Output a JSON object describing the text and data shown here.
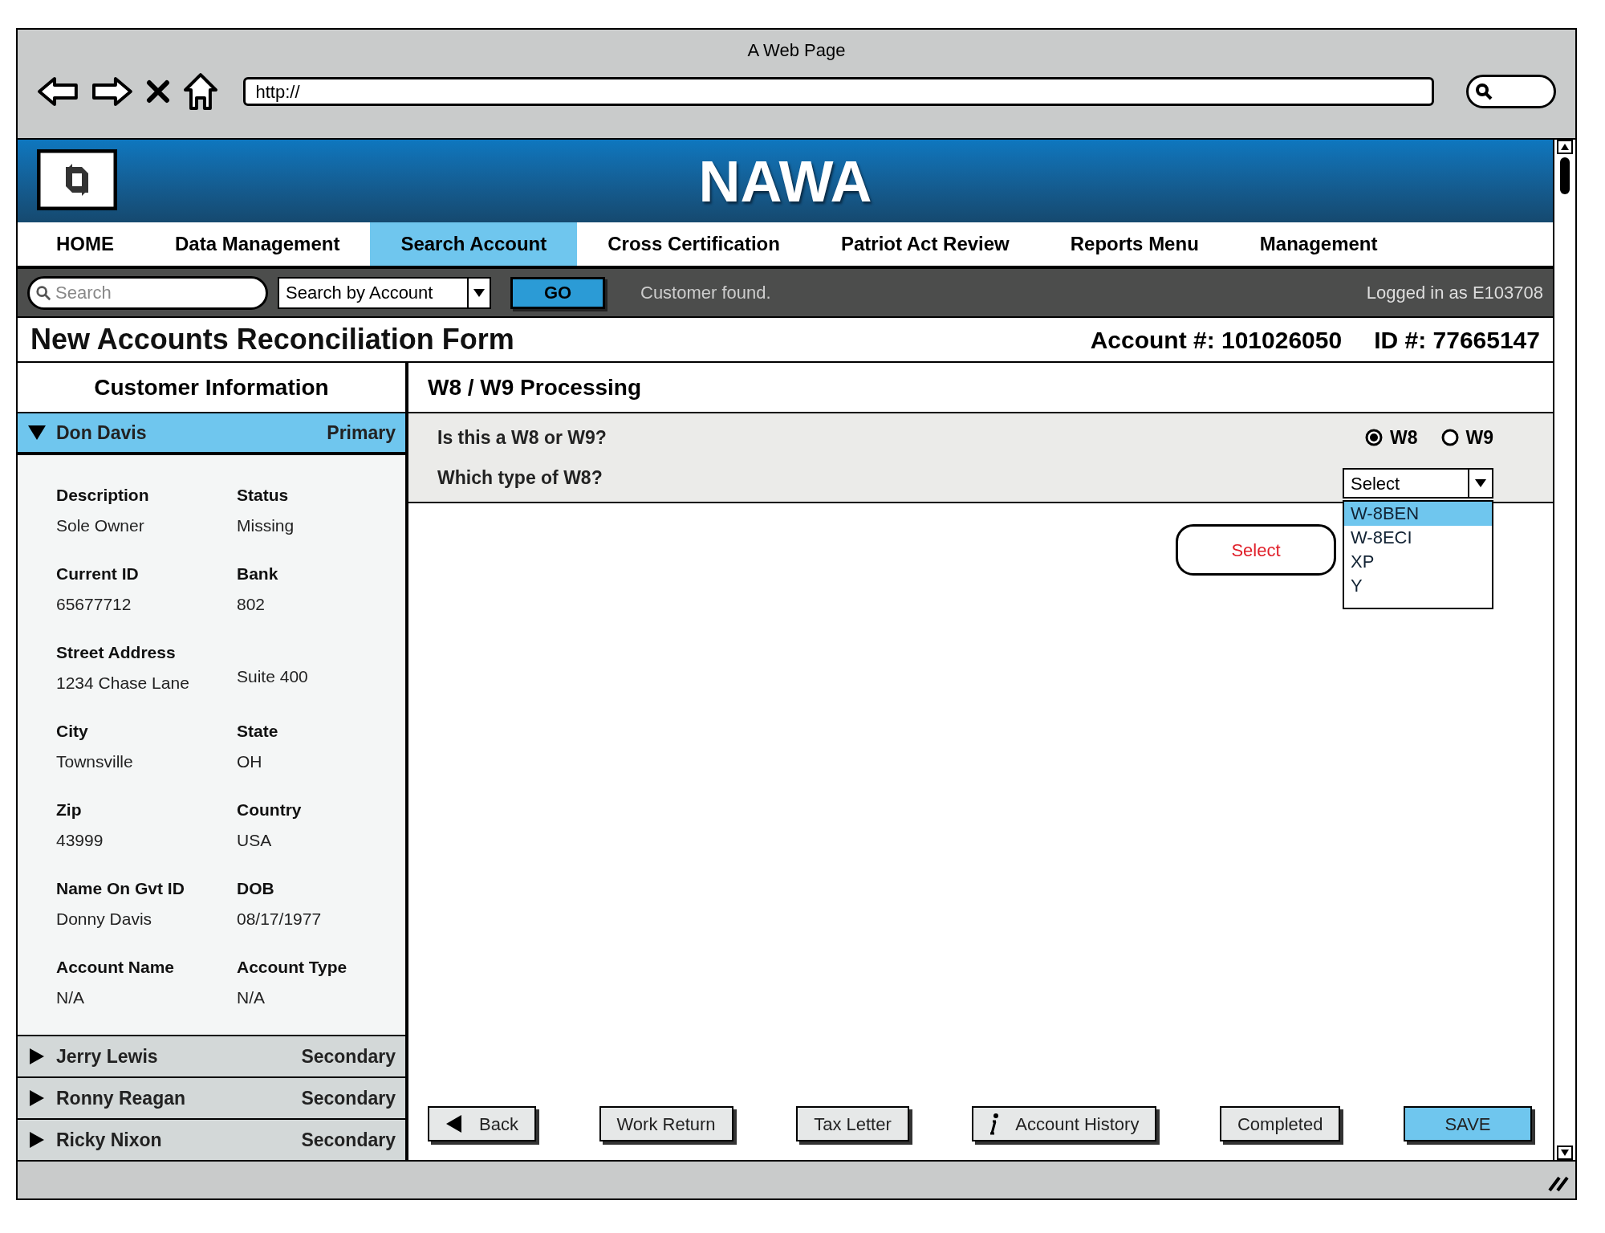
{
  "window": {
    "title": "A Web Page"
  },
  "browser": {
    "url": "http://"
  },
  "header": {
    "app_title": "NAWA"
  },
  "nav": [
    {
      "label": "HOME",
      "selected": false
    },
    {
      "label": "Data Management",
      "selected": false
    },
    {
      "label": "Search Account",
      "selected": true
    },
    {
      "label": "Cross Certification",
      "selected": false
    },
    {
      "label": "Patriot Act Review",
      "selected": false
    },
    {
      "label": "Reports Menu",
      "selected": false
    },
    {
      "label": "Management",
      "selected": false
    }
  ],
  "toolbar": {
    "search_placeholder": "Search",
    "search_mode": "Search by Account",
    "go": "GO",
    "message": "Customer found.",
    "user": "Logged in as E103708"
  },
  "form": {
    "title": "New Accounts Reconciliation Form",
    "account": "Account #: 101026050",
    "id": "ID #: 77665147"
  },
  "customer_panel": {
    "title": "Customer Information",
    "customers": [
      {
        "name": "Don Davis",
        "role": "Primary",
        "expanded": true,
        "fields": [
          {
            "label": "Description",
            "value": "Sole Owner"
          },
          {
            "label": "Status",
            "value": "Missing"
          },
          {
            "label": "Current ID",
            "value": "65677712"
          },
          {
            "label": "Bank",
            "value": "802"
          },
          {
            "label": "Street Address",
            "value": "1234 Chase Lane"
          },
          {
            "value": "Suite 400"
          },
          {
            "label": "City",
            "value": "Townsville"
          },
          {
            "label": "State",
            "value": "OH"
          },
          {
            "label": "Zip",
            "value": "43999"
          },
          {
            "label": "Country",
            "value": "USA"
          },
          {
            "label": "Name On Gvt ID",
            "value": "Donny Davis"
          },
          {
            "label": "DOB",
            "value": "08/17/1977"
          },
          {
            "label": "Account Name",
            "value": "N/A"
          },
          {
            "label": "Account Type",
            "value": "N/A"
          }
        ]
      },
      {
        "name": "Jerry Lewis",
        "role": "Secondary",
        "expanded": false
      },
      {
        "name": "Ronny Reagan",
        "role": "Secondary",
        "expanded": false
      },
      {
        "name": "Ricky Nixon",
        "role": "Secondary",
        "expanded": false
      }
    ]
  },
  "processing": {
    "title": "W8 / W9 Processing",
    "questions": [
      {
        "kind": "radio",
        "text": "Is this a W8 or W9?",
        "options": [
          {
            "label": "W8",
            "selected": true
          },
          {
            "label": "W9",
            "selected": false
          }
        ]
      },
      {
        "kind": "select",
        "text": "Which type of W8?",
        "value": "Select",
        "expanded": true,
        "options": [
          {
            "label": "W-8BEN",
            "selected": true
          },
          {
            "label": "W-8ECI",
            "selected": false
          },
          {
            "label": "XP",
            "selected": false
          },
          {
            "label": "Y",
            "selected": false
          }
        ]
      }
    ],
    "callout": "Select"
  },
  "buttons": [
    {
      "label": "Back",
      "kind": "back"
    },
    {
      "label": "Work Return",
      "kind": "plain"
    },
    {
      "label": "Tax Letter",
      "kind": "plain"
    },
    {
      "label": "Account History",
      "kind": "info"
    },
    {
      "label": "Completed",
      "kind": "plain"
    },
    {
      "label": "SAVE",
      "kind": "primary"
    }
  ]
}
